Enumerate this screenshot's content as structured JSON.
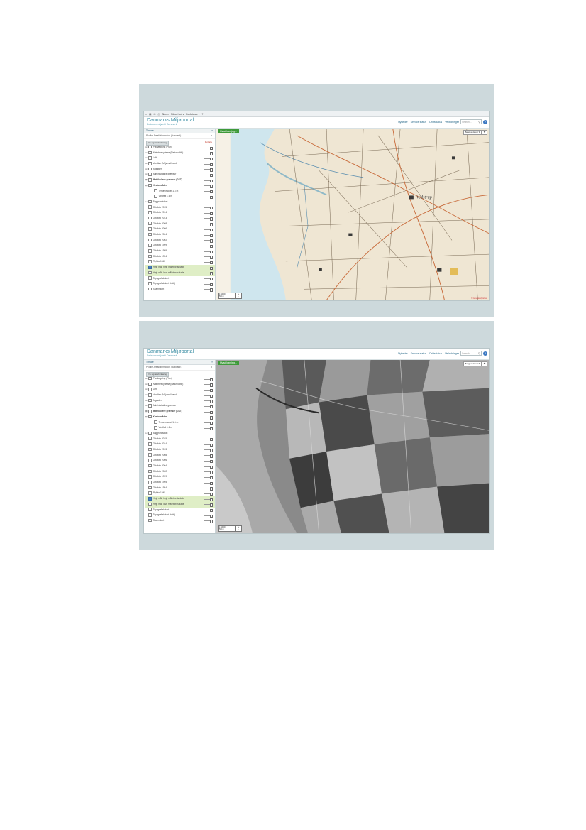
{
  "toolbar": {
    "items": [
      "Side ▾",
      "Sikkerhed ▾",
      "Funktioner ▾"
    ]
  },
  "brand": {
    "title": "Danmarks Miljøportal",
    "subtitle": "Data om miljøet i Danmark"
  },
  "nav": {
    "items": [
      "Nyheder",
      "Service status",
      "Driftsstatus",
      "Vejledninger"
    ]
  },
  "search": {
    "placeholder": "Search..."
  },
  "sidebar": {
    "header": "Temaer",
    "profile": "Profile: Arealinformation (standard)",
    "btn": "Vis signaturforklaring",
    "clear": "Ryd alle",
    "layers": [
      {
        "label": "Planlægning (Plan)",
        "exp": "⊞",
        "level": 1,
        "cb": false,
        "bold": false,
        "hl": false
      },
      {
        "label": "Naturbeskyttelse (Naturpolitik)",
        "exp": "⊞",
        "level": 1,
        "cb": false,
        "bold": false,
        "hl": false
      },
      {
        "label": "Luft",
        "exp": "⊞",
        "level": 1,
        "cb": false,
        "bold": false,
        "hl": false
      },
      {
        "label": "Vandløb (Miljømål/vand)",
        "exp": "⊞",
        "level": 1,
        "cb": false,
        "bold": false,
        "hl": false
      },
      {
        "label": "Afgrøder",
        "exp": "⊞",
        "level": 1,
        "cb": false,
        "bold": false,
        "hl": false
      },
      {
        "label": "Administrative grænser",
        "exp": "⊞",
        "level": 1,
        "cb": false,
        "bold": false,
        "hl": false
      },
      {
        "label": "Matrikulære grænser (GST)",
        "exp": "⊞",
        "level": 1,
        "cb": false,
        "bold": true,
        "hl": false
      },
      {
        "label": "Kystområder",
        "exp": "⊟",
        "level": 1,
        "cb": false,
        "bold": true,
        "hl": false
      },
      {
        "label": "Terrænmodel 1.6 m",
        "exp": "",
        "level": 2,
        "cb": false,
        "bold": false,
        "hl": false
      },
      {
        "label": "Vindfelt 1.6 m",
        "exp": "",
        "level": 2,
        "cb": false,
        "bold": false,
        "hl": false
      },
      {
        "label": "Baggrundskort",
        "exp": "⊟",
        "level": 0,
        "cb": false,
        "bold": false,
        "hl": false
      },
      {
        "label": "Ortofoto 2015",
        "exp": "",
        "level": 1,
        "cb": false,
        "bold": false,
        "hl": false
      },
      {
        "label": "Ortofoto 2014",
        "exp": "",
        "level": 1,
        "cb": false,
        "bold": false,
        "hl": false
      },
      {
        "label": "Ortofoto 2013",
        "exp": "",
        "level": 1,
        "cb": false,
        "bold": false,
        "hl": false
      },
      {
        "label": "Ortofoto 2008",
        "exp": "",
        "level": 1,
        "cb": false,
        "bold": false,
        "hl": false
      },
      {
        "label": "Ortofoto 2006",
        "exp": "",
        "level": 1,
        "cb": false,
        "bold": false,
        "hl": false
      },
      {
        "label": "Ortofoto 2004",
        "exp": "",
        "level": 1,
        "cb": false,
        "bold": false,
        "hl": false
      },
      {
        "label": "Ortofoto 2002",
        "exp": "",
        "level": 1,
        "cb": false,
        "bold": false,
        "hl": false
      },
      {
        "label": "Ortofoto 1999",
        "exp": "",
        "level": 1,
        "cb": false,
        "bold": false,
        "hl": false
      },
      {
        "label": "Ortofoto 1995",
        "exp": "",
        "level": 1,
        "cb": false,
        "bold": false,
        "hl": false
      },
      {
        "label": "Ortofoto 1954",
        "exp": "",
        "level": 1,
        "cb": false,
        "bold": false,
        "hl": false
      },
      {
        "label": "Flyfoto 1945",
        "exp": "",
        "level": 1,
        "cb": false,
        "bold": false,
        "hl": false
      },
      {
        "label": "Høje mål. høje målebordsblade",
        "exp": "",
        "level": 1,
        "cb": true,
        "bold": false,
        "hl": true
      },
      {
        "label": "Høje mål. lave målebordsblade",
        "exp": "",
        "level": 1,
        "cb": false,
        "bold": false,
        "hl": true
      },
      {
        "label": "Topografisk kort",
        "exp": "",
        "level": 1,
        "cb": false,
        "bold": false,
        "hl": false
      },
      {
        "label": "Topografisk kort (bidt)",
        "exp": "",
        "level": 1,
        "cb": false,
        "bold": false,
        "hl": false
      },
      {
        "label": "Skærmkort",
        "exp": "",
        "level": 1,
        "cb": false,
        "bold": false,
        "hl": false
      }
    ]
  },
  "map": {
    "hvad_btn": "Hvad kan jeg...",
    "bg_select": "Baggrundskort ▾",
    "tools_icon": "⚒",
    "scale_text": "1:50000",
    "scale_unit": "500 m",
    "zoom_plus": "+",
    "zoom_minus": "-",
    "attribution": "© Geodatastyrelsen",
    "label_town": "Vedstrup"
  },
  "colors": {
    "brand": "#3a8ea4",
    "nav": "#2a6a8a",
    "green_button": "#3e9a3a",
    "panel_bg": "#cdd9dc",
    "highlight": "#dfeec6",
    "map_paper": "#efe6d3",
    "map_water": "#cfe6ee",
    "sat_field_dark": "#3c3c3c",
    "sat_field_light": "#b8b8b8"
  }
}
